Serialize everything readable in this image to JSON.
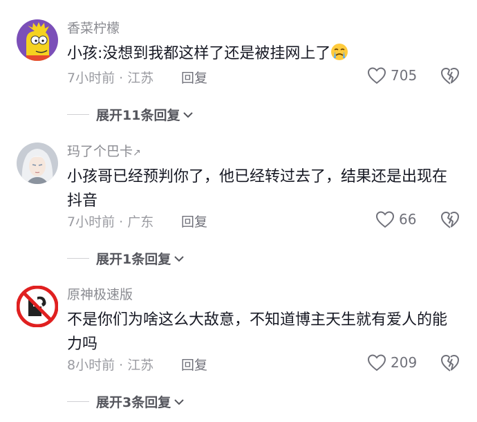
{
  "comments": [
    {
      "username": "香菜柠檬",
      "text": "小孩:没想到我都这样了还是被挂网上了",
      "emoji": "crying-face-icon",
      "time_location": "7小时前 · 江苏",
      "reply_label": "回复",
      "likes": "705",
      "expand_label": "展开11条回复"
    },
    {
      "username": "玛了个巴卡",
      "username_suffix": "↗",
      "text": "小孩哥已经预判你了，他已经转过去了，结果还是出现在抖音",
      "time_location": "7小时前 · 广东",
      "reply_label": "回复",
      "likes": "66",
      "expand_label": "展开1条回复"
    },
    {
      "username": "原神极速版",
      "text": "不是你们为啥这么大敌意，不知道博主天生就有爱人的能力吗",
      "time_location": "8小时前 · 江苏",
      "reply_label": "回复",
      "likes": "209",
      "expand_label": "展开3条回复"
    }
  ],
  "colors": {
    "text": "#161823",
    "muted": "#9a9ba1",
    "username": "#8a8b91",
    "expand": "#54555c"
  }
}
